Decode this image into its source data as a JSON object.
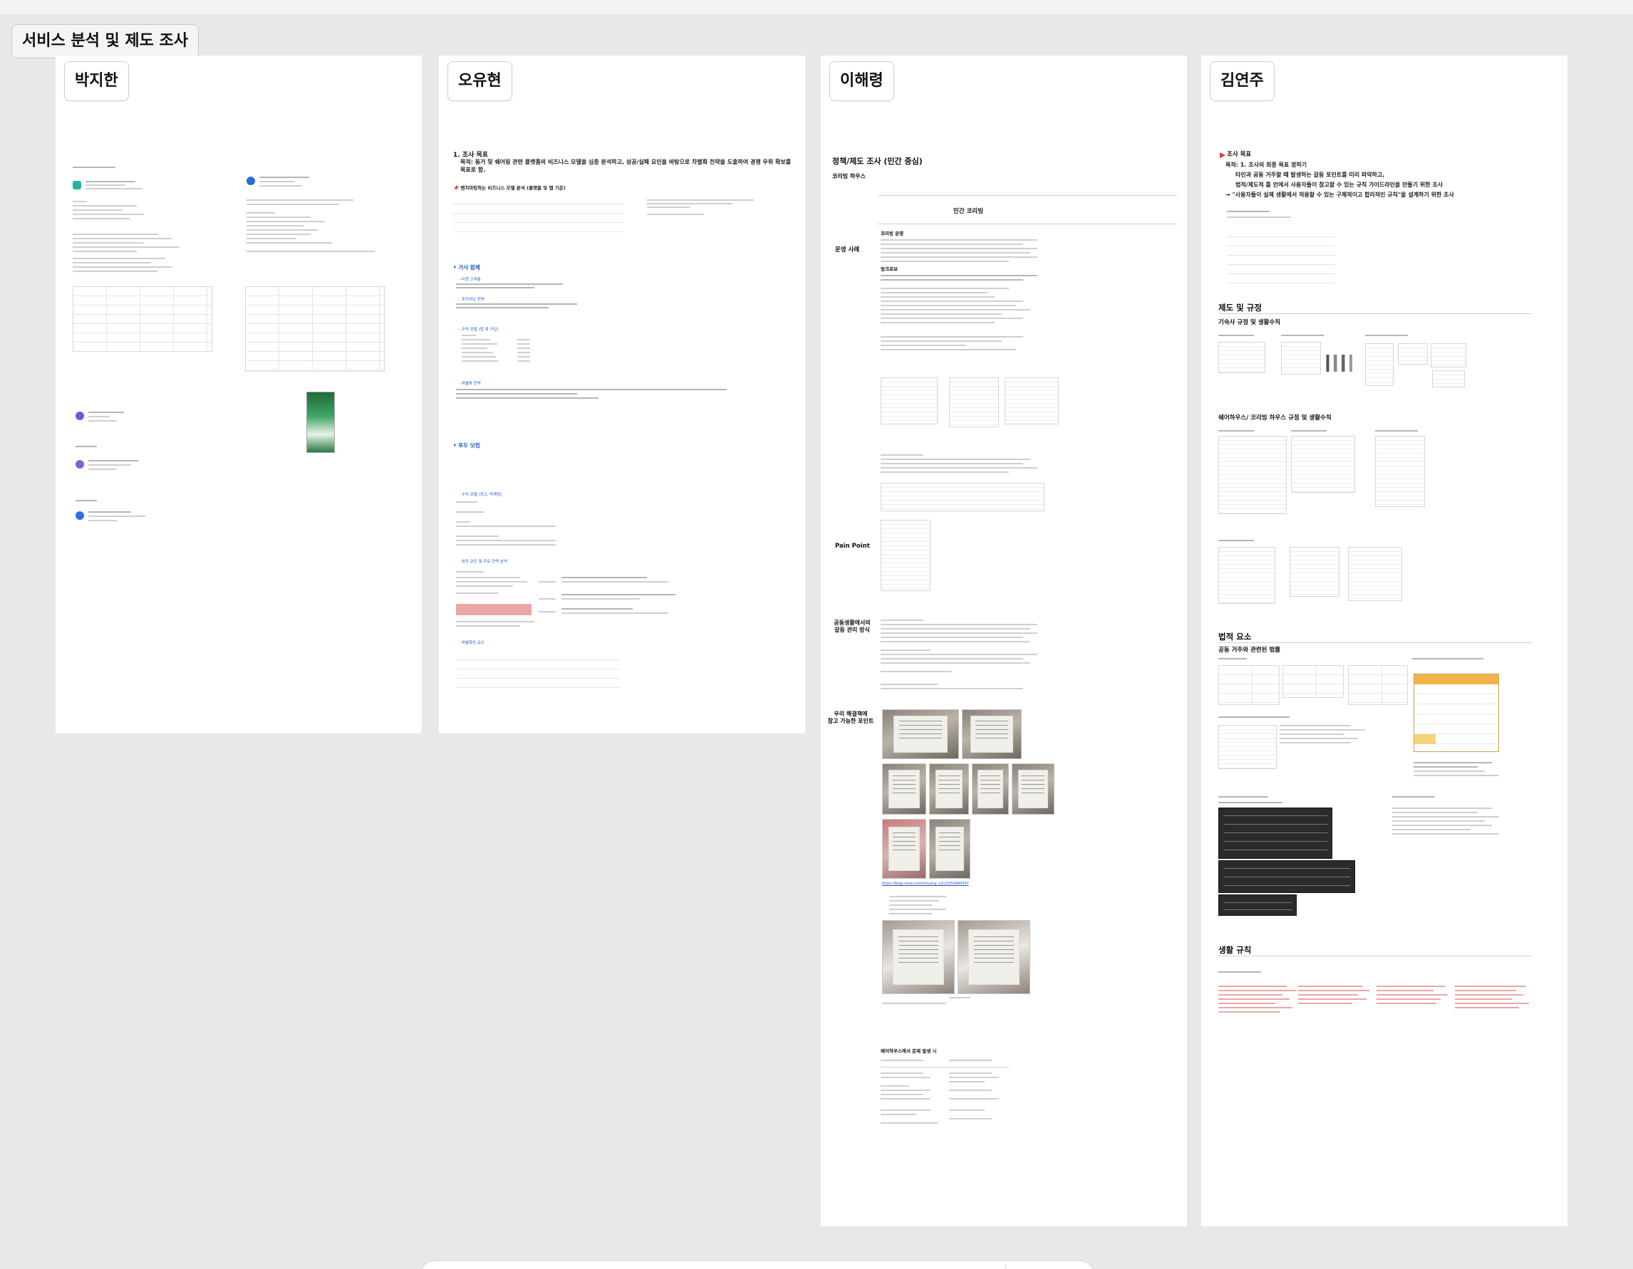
{
  "board": {
    "section_title": "서비스 분석 및 제도 조사"
  },
  "panels": [
    {
      "name": "박지한",
      "notes": []
    },
    {
      "name": "오유현",
      "heading": "1. 조사 목표",
      "goal": "목적: 동거 및 쉐어링 관련 플랫폼의 비즈니스 모델을 심층 분석하고, 성공/실패 요인을 바탕으로 차별화 전략을 도출하여 경쟁 우위 확보를 목표로 함.",
      "table_title": "📌 벤치마킹하는 비즈니스 모델 분석 (플랫폼 및 앱 기준)",
      "blocks": [
        "• 가사 합께",
        "- 타겟 고객층",
        "- 포지셔닝 전략",
        "- 수익 모델 (앱 내 구입)",
        "- 차별화 전략",
        "• 투두 닷컴",
        "- 수익 모델 (광고, 마케팅)",
        "- 성공 요인 및 주요 전략 분석",
        "- 차별화된 요소"
      ]
    },
    {
      "name": "이해령",
      "doc_title": "정책/제도 조사 (민간 중심)",
      "doc_subtitle": "코리빙 하우스",
      "col_title": "민간 코리빙",
      "row_labels": [
        "운영 사례",
        "Pain Point",
        "공동생활에서의\n갈등 관리 방식",
        "우리 해결책에\n참고 가능한 포인트"
      ],
      "right_labels": [
        "코리빙 운영",
        "링크로보"
      ],
      "link_1": "https://blog.naver.com/hoyang_s/223354940547",
      "footer_heading": "쉐어하우스에서 문제 발생 시"
    },
    {
      "name": "김연주",
      "heading": "조사 목표",
      "goal_lines": [
        "목적: 1. 조사의 최종 목표 정하기",
        "타인과 공동 거주할 때 발생하는 갈등 포인트를 미리 파악하고,",
        "법적/제도적 틀 안에서 사용자들이 참고할 수 있는 규칙 가이드라인을 만들기 위한 조사",
        "→ \"사용자들이 실제 생활에서 적용할 수 있는 구체적이고 합리적인 규칙\"을 설계하기 위한 조사"
      ],
      "sections": [
        "제도 및 규정",
        "기숙사 규정 및 생활수칙",
        "쉐어하우스/ 코리빙 하우스 규정 및 생활수칙",
        "법적 요소",
        "공동 거주와 관련된 법률",
        "생활 규칙"
      ]
    }
  ],
  "colors": {
    "canvas": "#e8e8e8",
    "panel": "#ffffff",
    "accent_red": "#d43b3b",
    "link_blue": "#2356c8"
  }
}
